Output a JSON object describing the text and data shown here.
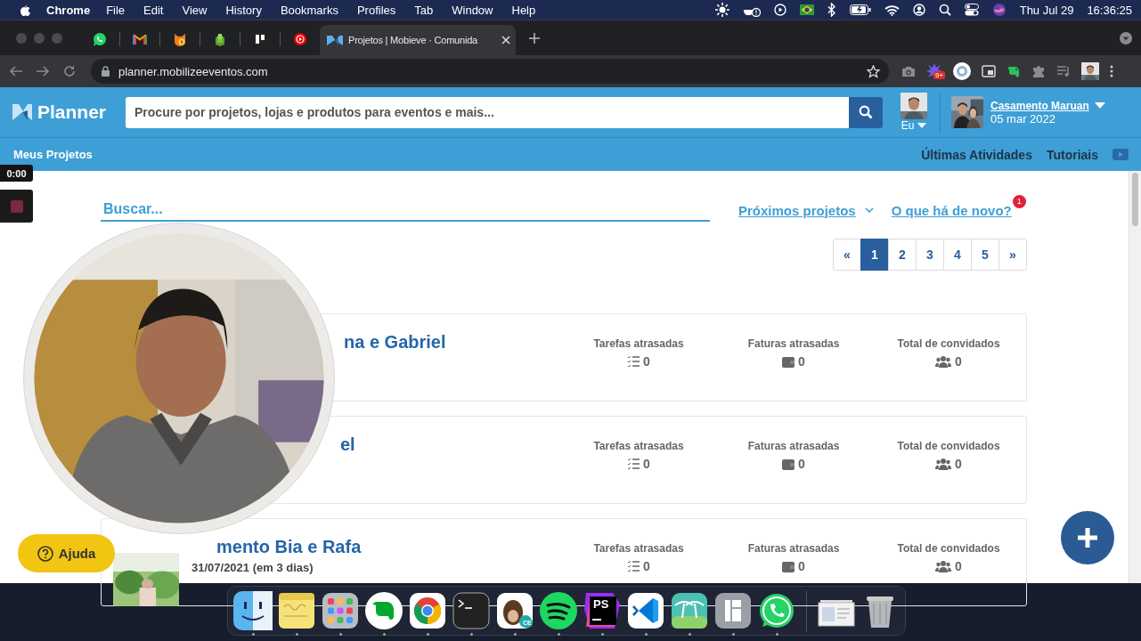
{
  "menubar": {
    "app": "Chrome",
    "menus": [
      "File",
      "Edit",
      "View",
      "History",
      "Bookmarks",
      "Profiles",
      "Tab",
      "Window",
      "Help"
    ],
    "date": "Thu Jul 29",
    "time": "16:36:25"
  },
  "browser": {
    "tab": {
      "title": "Projetos | Mobieve · Comunida",
      "selected": true
    },
    "url": "planner.mobilizeeventos.com",
    "extension_badge": "9+"
  },
  "header": {
    "logo": "Planner",
    "search_placeholder": "Procure por projetos, lojas e produtos para eventos e mais...",
    "user_label": "Eu",
    "project_name": "Casamento Maruan",
    "project_date": "05 mar 2022"
  },
  "nav": {
    "left": "Meus Projetos",
    "right": [
      "Últimas Atividades",
      "Tutoriais"
    ]
  },
  "recorder": {
    "time": "0:00"
  },
  "filter": {
    "placeholder": "Buscar...",
    "sort": "Próximos projetos",
    "news": "O que há de novo?",
    "news_badge": "1"
  },
  "pagination": {
    "prev": "«",
    "next": "»",
    "pages": [
      {
        "label": "1",
        "selected": true
      },
      {
        "label": "2",
        "selected": false
      },
      {
        "label": "3",
        "selected": false
      },
      {
        "label": "4",
        "selected": false
      },
      {
        "label": "5",
        "selected": false
      }
    ]
  },
  "projects": [
    {
      "title": "na e Gabriel",
      "stats": [
        {
          "kind": "tasks",
          "label": "Tarefas atrasadas",
          "value": "0"
        },
        {
          "kind": "invoices",
          "label": "Faturas atrasadas",
          "value": "0"
        },
        {
          "kind": "guests",
          "label": "Total de convidados",
          "value": "0"
        }
      ]
    },
    {
      "title": "el",
      "stats": [
        {
          "kind": "tasks",
          "label": "Tarefas atrasadas",
          "value": "0"
        },
        {
          "kind": "invoices",
          "label": "Faturas atrasadas",
          "value": "0"
        },
        {
          "kind": "guests",
          "label": "Total de convidados",
          "value": "0"
        }
      ]
    },
    {
      "title": "mento Bia e Rafa",
      "date": "31/07/2021 (em 3 dias)",
      "stats": [
        {
          "kind": "tasks",
          "label": "Tarefas atrasadas",
          "value": "0"
        },
        {
          "kind": "invoices",
          "label": "Faturas atrasadas",
          "value": "0"
        },
        {
          "kind": "guests",
          "label": "Total de convidados",
          "value": "0"
        }
      ]
    }
  ],
  "help_button": "Ajuda",
  "dock": [
    {
      "kind": "finder",
      "running": true
    },
    {
      "kind": "notes",
      "running": true
    },
    {
      "kind": "launchpad",
      "running": true
    },
    {
      "kind": "evernote",
      "running": true
    },
    {
      "kind": "chrome",
      "running": true
    },
    {
      "kind": "terminal",
      "running": true
    },
    {
      "kind": "beaver",
      "label": "CE",
      "running": true
    },
    {
      "kind": "spotify",
      "running": true
    },
    {
      "kind": "ide",
      "label": "PS",
      "running": true
    },
    {
      "kind": "vscode",
      "running": true
    },
    {
      "kind": "palms",
      "running": true
    },
    {
      "kind": "dash",
      "running": true
    },
    {
      "kind": "whatsapp",
      "running": true
    },
    {
      "kind": "separator"
    },
    {
      "kind": "stack"
    },
    {
      "kind": "trash"
    }
  ]
}
